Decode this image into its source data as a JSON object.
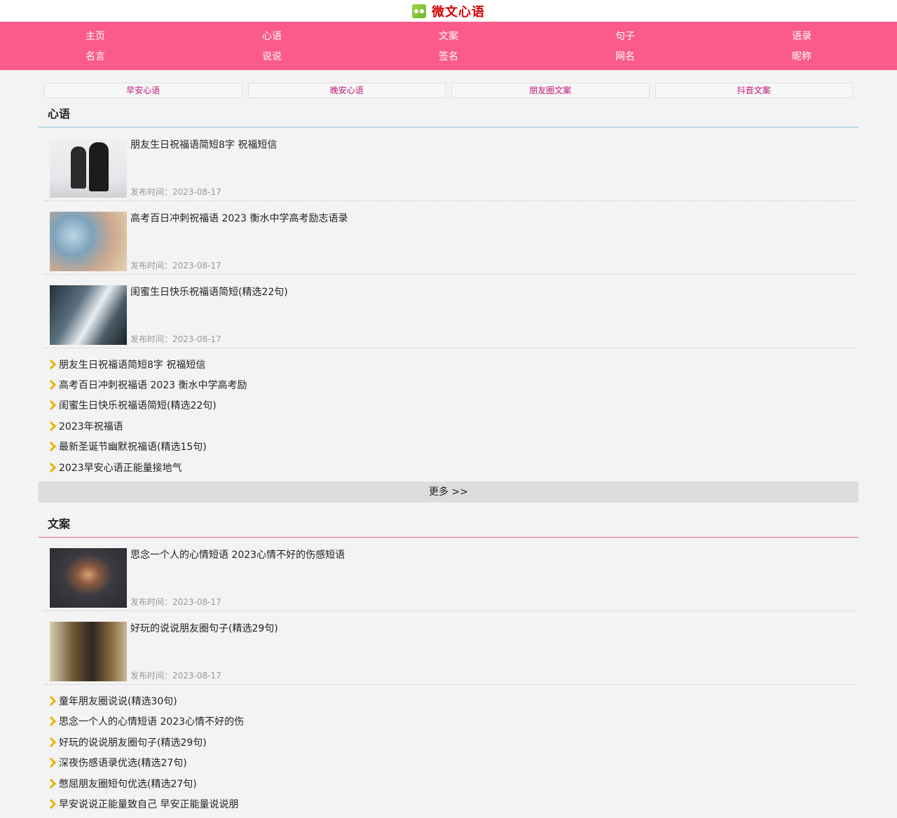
{
  "site": {
    "title": "微文心语",
    "logo_icon": "flower-icon"
  },
  "nav": {
    "row1": [
      "主页",
      "心语",
      "文案",
      "句子",
      "语录"
    ],
    "row2": [
      "名言",
      "说说",
      "签名",
      "网名",
      "昵称"
    ]
  },
  "subnav": [
    "早安心语",
    "晚安心语",
    "朋友圈文案",
    "抖音文案"
  ],
  "sections": [
    {
      "title": "心语",
      "articles": [
        {
          "title": "朋友生日祝福语简短8字 祝福短信",
          "date": "发布时间：2023-08-17"
        },
        {
          "title": "高考百日冲刺祝福语 2023 衡水中学高考励志语录",
          "date": "发布时间：2023-08-17"
        },
        {
          "title": "闺蜜生日快乐祝福语简短(精选22句)",
          "date": "发布时间：2023-08-17"
        }
      ],
      "links": [
        "朋友生日祝福语简短8字 祝福短信",
        "高考百日冲刺祝福语 2023 衡水中学高考励",
        "闺蜜生日快乐祝福语简短(精选22句)",
        "2023年祝福语",
        "最新圣诞节幽默祝福语(精选15句)",
        "2023早安心语正能量接地气"
      ],
      "more": "更多 >>"
    },
    {
      "title": "文案",
      "articles": [
        {
          "title": "思念一个人的心情短语 2023心情不好的伤感短语",
          "date": "发布时间：2023-08-17"
        },
        {
          "title": "好玩的说说朋友圈句子(精选29句)",
          "date": "发布时间：2023-08-17"
        }
      ],
      "links": [
        "童年朋友圈说说(精选30句)",
        "思念一个人的心情短语 2023心情不好的伤",
        "好玩的说说朋友圈句子(精选29句)",
        "深夜伤感语录优选(精选27句)",
        "憋屈朋友圈短句优选(精选27句)",
        "早安说说正能量致自己 早安正能量说说朋"
      ]
    }
  ],
  "colors": {
    "nav_bg": "#fb5b8b",
    "logo_text": "#d40000",
    "subnav_text": "#c0137a",
    "chevron": "#e8b400"
  }
}
